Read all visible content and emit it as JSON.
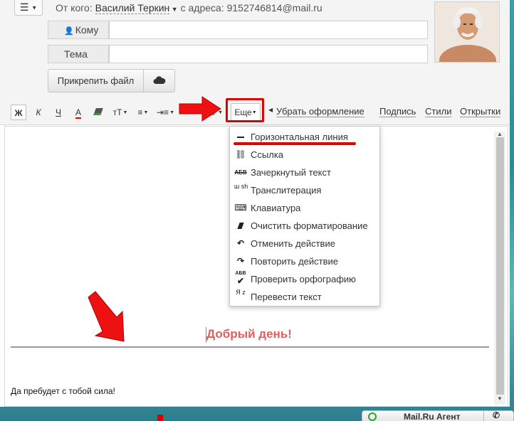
{
  "header": {
    "menu_icon": "☰",
    "from_prefix": "От кого:",
    "from_name": "Василий Теркин",
    "from_mid": "с адреса:",
    "from_email": "9152746814@mail.ru",
    "to_label": "Кому",
    "to_value": "",
    "subject_label": "Тема",
    "subject_value": "",
    "attach_label": "Прикрепить файл",
    "cloud_icon": "cloud-icon",
    "avatar_icon": "avatar"
  },
  "toolbar": {
    "bold": "Ж",
    "italic": "К",
    "underline": "Ч",
    "text_color": "А",
    "bg_color_icon": "highlighter-icon",
    "font_size": "тТ",
    "align_icon": "align-icon",
    "indent_icon": "indent-icon",
    "smile_icon": "smile-icon",
    "more_label": "Еще",
    "clear_format": "Убрать оформление",
    "signature": "Подпись",
    "styles": "Стили",
    "cards": "Открытки"
  },
  "dropdown": {
    "items": [
      {
        "icon": "hr-icon",
        "label": "Горизонтальная линия"
      },
      {
        "icon": "link-icon",
        "label": "Ссылка"
      },
      {
        "icon": "strikethrough-icon",
        "glyph": "АБВ",
        "label": "Зачеркнутый текст"
      },
      {
        "icon": "translit-icon",
        "glyph": "ш sh",
        "label": "Транслитерация"
      },
      {
        "icon": "keyboard-icon",
        "label": "Клавиатура"
      },
      {
        "icon": "eraser-icon",
        "label": "Очистить форматирование"
      },
      {
        "icon": "undo-icon",
        "label": "Отменить действие"
      },
      {
        "icon": "redo-icon",
        "label": "Повторить действие"
      },
      {
        "icon": "spellcheck-icon",
        "glyph": "АБВ",
        "label": "Проверить орфографию"
      },
      {
        "icon": "translate-icon",
        "glyph": "Я z",
        "label": "Перевести текст"
      }
    ]
  },
  "editor": {
    "greeting": "Добрый день!",
    "footer_text": "Да пребудет с тобой сила!"
  },
  "agent": {
    "label": "Mail.Ru Агент"
  },
  "colors": {
    "highlight_red": "#e00000",
    "greeting_color": "#e06060"
  }
}
